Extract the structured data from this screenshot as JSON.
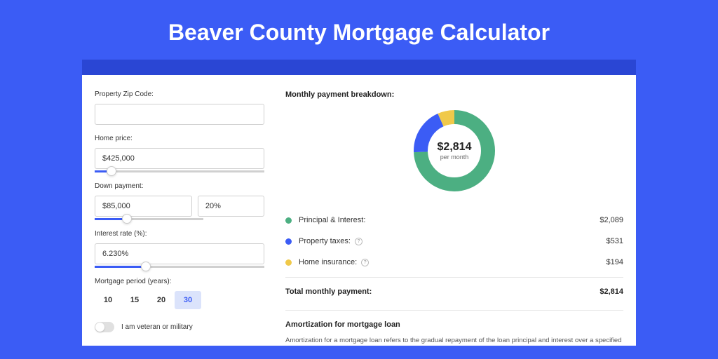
{
  "page": {
    "title": "Beaver County Mortgage Calculator"
  },
  "form": {
    "zip_label": "Property Zip Code:",
    "zip_value": "",
    "home_price_label": "Home price:",
    "home_price_value": "$425,000",
    "down_payment_label": "Down payment:",
    "down_payment_value": "$85,000",
    "down_payment_pct": "20%",
    "interest_label": "Interest rate (%):",
    "interest_value": "6.230%",
    "period_label": "Mortgage period (years):",
    "periods": [
      "10",
      "15",
      "20",
      "30"
    ],
    "period_active": "30",
    "veteran_label": "I am veteran or military"
  },
  "breakdown": {
    "title": "Monthly payment breakdown:",
    "donut_amount": "$2,814",
    "donut_sub": "per month",
    "items": [
      {
        "label": "Principal & Interest:",
        "value": "$2,089",
        "color": "#4caf82",
        "info": false
      },
      {
        "label": "Property taxes:",
        "value": "$531",
        "color": "#3b5cf5",
        "info": true
      },
      {
        "label": "Home insurance:",
        "value": "$194",
        "color": "#f0c94a",
        "info": true
      }
    ],
    "total_label": "Total monthly payment:",
    "total_value": "$2,814"
  },
  "amortization": {
    "title": "Amortization for mortgage loan",
    "text": "Amortization for a mortgage loan refers to the gradual repayment of the loan principal and interest over a specified"
  },
  "chart_data": {
    "type": "pie",
    "title": "Monthly payment breakdown",
    "series": [
      {
        "name": "Principal & Interest",
        "value": 2089,
        "color": "#4caf82"
      },
      {
        "name": "Property taxes",
        "value": 531,
        "color": "#3b5cf5"
      },
      {
        "name": "Home insurance",
        "value": 194,
        "color": "#f0c94a"
      }
    ],
    "total": 2814
  }
}
